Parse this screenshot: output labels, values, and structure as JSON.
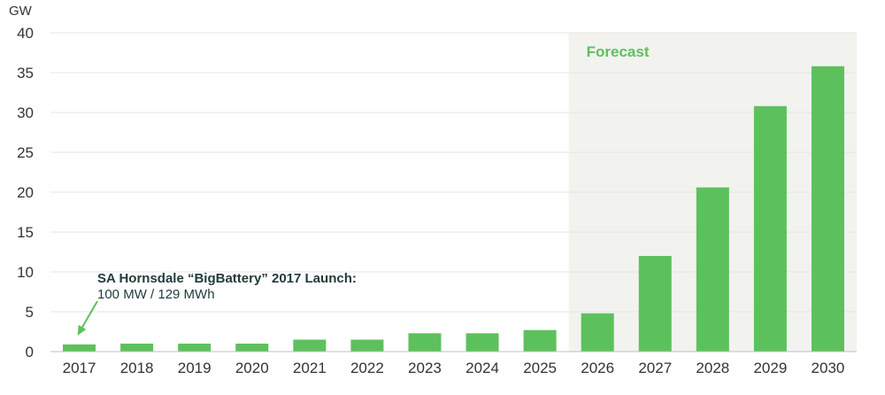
{
  "chart_data": {
    "type": "bar",
    "unit_label": "GW",
    "categories": [
      "2017",
      "2018",
      "2019",
      "2020",
      "2021",
      "2022",
      "2023",
      "2024",
      "2025",
      "2026",
      "2027",
      "2028",
      "2029",
      "2030"
    ],
    "values": [
      0.9,
      1.0,
      1.0,
      1.0,
      1.5,
      1.5,
      2.3,
      2.3,
      2.7,
      4.8,
      12.0,
      20.6,
      30.8,
      35.8
    ],
    "ylim": [
      0,
      40
    ],
    "yticks": [
      0,
      5,
      10,
      15,
      20,
      25,
      30,
      35,
      40
    ],
    "ytick_labels": [
      "0",
      "5",
      "10",
      "15",
      "20",
      "25",
      "30",
      "35",
      "40"
    ],
    "grid": true,
    "forecast_region": {
      "start_category": "2026",
      "end_category": "2030",
      "label": "Forecast"
    },
    "annotation": {
      "title": "SA Hornsdale “BigBattery” 2017 Launch:",
      "subtitle": "100 MW / 129 MWh",
      "target_category": "2017"
    },
    "colors": {
      "bar": "#5cc15c",
      "forecast_bg": "#f2f2ef",
      "forecast_text": "#5cc15c",
      "grid": "#e6e6e6",
      "arrow": "#5cc15c"
    }
  }
}
